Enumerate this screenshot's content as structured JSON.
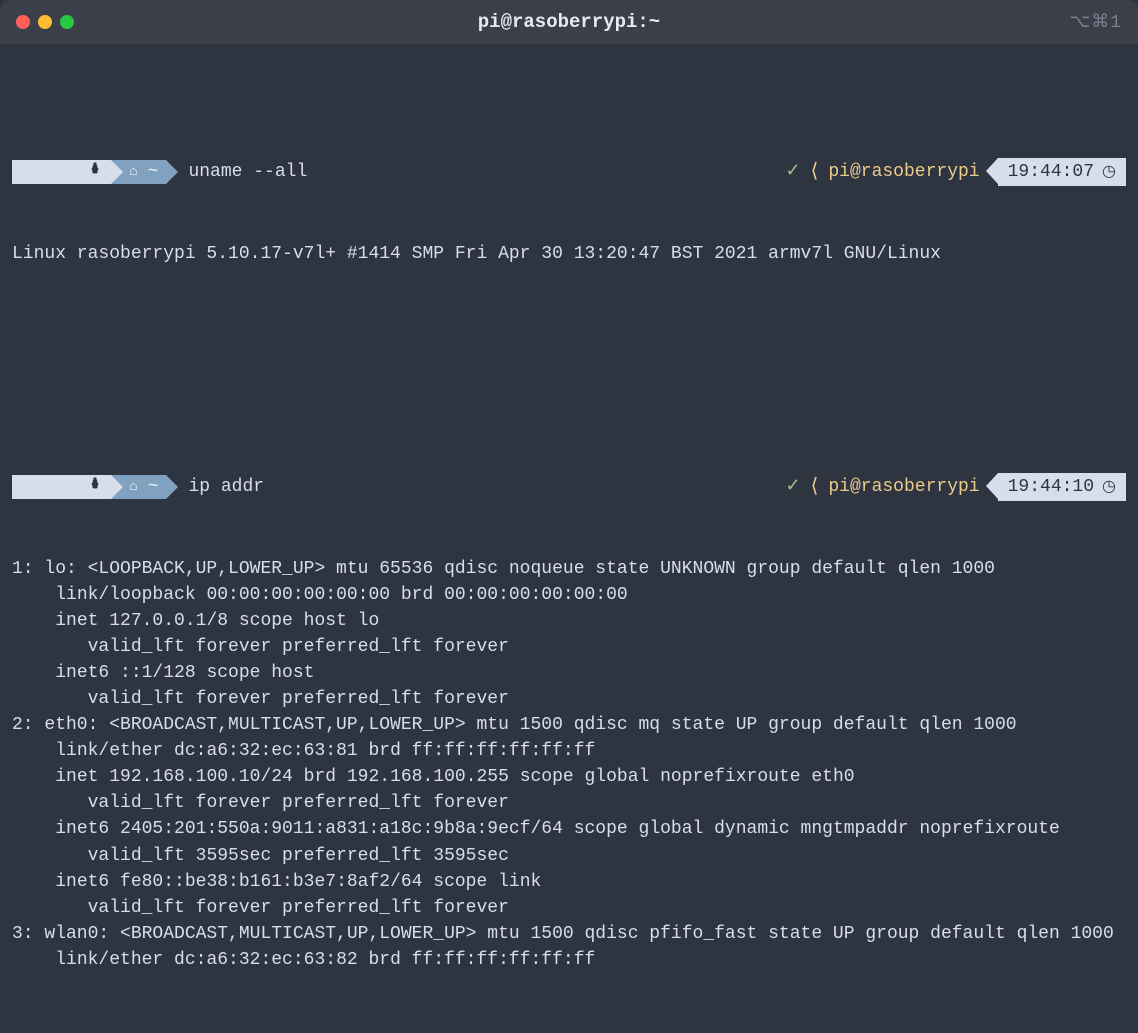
{
  "window": {
    "title": "pi@rasoberrypi:~",
    "right_indicator": "⌥⌘1"
  },
  "prompts": [
    {
      "os_icon": "raspberry-pi",
      "home_icon": "⌂",
      "tilde": "~",
      "command": "uname --all",
      "status_check": "✓",
      "user_host": "pi@rasoberrypi",
      "time": "19:44:07",
      "clock": "◷",
      "output": "Linux rasoberrypi 5.10.17-v7l+ #1414 SMP Fri Apr 30 13:20:47 BST 2021 armv7l GNU/Linux"
    },
    {
      "os_icon": "raspberry-pi",
      "home_icon": "⌂",
      "tilde": "~",
      "command": "ip addr",
      "status_check": "✓",
      "user_host": "pi@rasoberrypi",
      "time": "19:44:10",
      "clock": "◷",
      "output": "1: lo: <LOOPBACK,UP,LOWER_UP> mtu 65536 qdisc noqueue state UNKNOWN group default qlen 1000\n    link/loopback 00:00:00:00:00:00 brd 00:00:00:00:00:00\n    inet 127.0.0.1/8 scope host lo\n       valid_lft forever preferred_lft forever\n    inet6 ::1/128 scope host\n       valid_lft forever preferred_lft forever\n2: eth0: <BROADCAST,MULTICAST,UP,LOWER_UP> mtu 1500 qdisc mq state UP group default qlen 1000\n    link/ether dc:a6:32:ec:63:81 brd ff:ff:ff:ff:ff:ff\n    inet 192.168.100.10/24 brd 192.168.100.255 scope global noprefixroute eth0\n       valid_lft forever preferred_lft forever\n    inet6 2405:201:550a:9011:a831:a18c:9b8a:9ecf/64 scope global dynamic mngtmpaddr noprefixroute\n       valid_lft 3595sec preferred_lft 3595sec\n    inet6 fe80::be38:b161:b3e7:8af2/64 scope link\n       valid_lft forever preferred_lft forever\n3: wlan0: <BROADCAST,MULTICAST,UP,LOWER_UP> mtu 1500 qdisc pfifo_fast state UP group default qlen 1000\n    link/ether dc:a6:32:ec:63:82 brd ff:ff:ff:ff:ff:ff"
    }
  ]
}
